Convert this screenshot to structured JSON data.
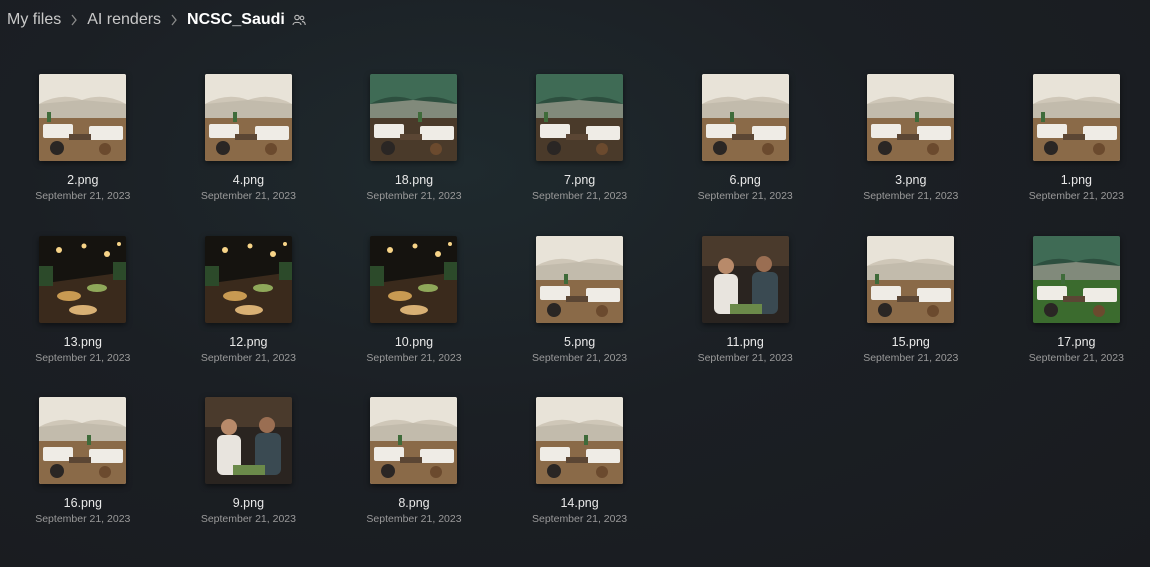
{
  "breadcrumb": {
    "items": [
      "My files",
      "AI renders"
    ],
    "current": "NCSC_Saudi",
    "shared_icon": "people-icon",
    "separator_icon": "chevron-right-icon"
  },
  "files": [
    {
      "name": "2.png",
      "date": "September 21, 2023",
      "scene": "tent-white"
    },
    {
      "name": "4.png",
      "date": "September 21, 2023",
      "scene": "tent-white"
    },
    {
      "name": "18.png",
      "date": "September 21, 2023",
      "scene": "tent-green"
    },
    {
      "name": "7.png",
      "date": "September 21, 2023",
      "scene": "tent-green"
    },
    {
      "name": "6.png",
      "date": "September 21, 2023",
      "scene": "tent-white"
    },
    {
      "name": "3.png",
      "date": "September 21, 2023",
      "scene": "tent-white"
    },
    {
      "name": "1.png",
      "date": "September 21, 2023",
      "scene": "tent-white"
    },
    {
      "name": "13.png",
      "date": "September 21, 2023",
      "scene": "dinner-night"
    },
    {
      "name": "12.png",
      "date": "September 21, 2023",
      "scene": "dinner-night"
    },
    {
      "name": "10.png",
      "date": "September 21, 2023",
      "scene": "dinner-night"
    },
    {
      "name": "5.png",
      "date": "September 21, 2023",
      "scene": "tent-white"
    },
    {
      "name": "11.png",
      "date": "September 21, 2023",
      "scene": "people"
    },
    {
      "name": "15.png",
      "date": "September 21, 2023",
      "scene": "tent-white"
    },
    {
      "name": "17.png",
      "date": "September 21, 2023",
      "scene": "tent-green-lawn"
    },
    {
      "name": "16.png",
      "date": "September 21, 2023",
      "scene": "tent-white"
    },
    {
      "name": "9.png",
      "date": "September 21, 2023",
      "scene": "people"
    },
    {
      "name": "8.png",
      "date": "September 21, 2023",
      "scene": "tent-white"
    },
    {
      "name": "14.png",
      "date": "September 21, 2023",
      "scene": "tent-white"
    }
  ]
}
